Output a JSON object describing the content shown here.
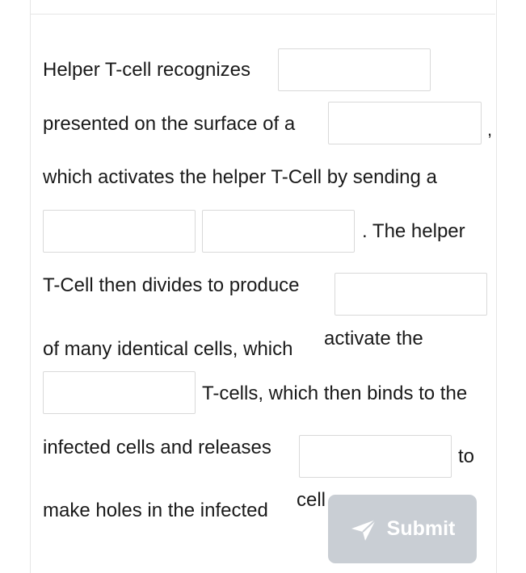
{
  "passage": {
    "line1": "Helper T-cell recognizes",
    "line2": "presented on the surface of a",
    "comma": ",",
    "line3": "which activates the helper T-Cell by sending a",
    "line4": ". The helper",
    "line5": "T-Cell then divides to produce",
    "line6a": "of many identical cells, which",
    "line6b": "activate the",
    "line7": "T-cells, which then binds to the",
    "line8": "infected cells and releases",
    "line8_to": "to",
    "line9a": "make holes in the infected",
    "line9b": "cell"
  },
  "blanks": [
    "",
    "",
    "",
    "",
    "",
    "",
    ""
  ],
  "submit": {
    "label": "Submit",
    "icon": "send-icon"
  }
}
